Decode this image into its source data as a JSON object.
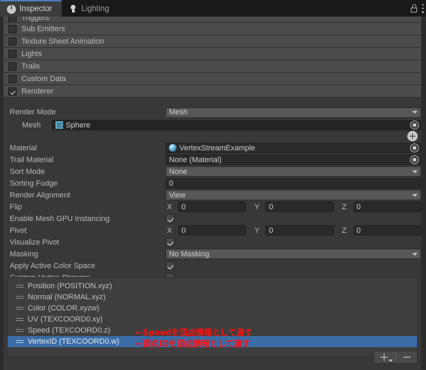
{
  "window": {
    "title": "Inspector",
    "lock_icon": "lock-icon",
    "menu_icon": "kebab-menu-icon"
  },
  "tabs": [
    {
      "label": "Inspector",
      "icon": "info-icon",
      "active": true
    },
    {
      "label": "Lighting",
      "icon": "lightbulb-icon",
      "active": false
    }
  ],
  "modules": [
    {
      "label": "Triggers",
      "checked": false,
      "clipped": true
    },
    {
      "label": "Sub Emitters",
      "checked": false
    },
    {
      "label": "Texture Sheet Animation",
      "checked": false
    },
    {
      "label": "Lights",
      "checked": false
    },
    {
      "label": "Trails",
      "checked": false
    },
    {
      "label": "Custom Data",
      "checked": false
    },
    {
      "label": "Renderer",
      "checked": true
    }
  ],
  "renderer": {
    "render_mode": {
      "label": "Render Mode",
      "value": "Mesh"
    },
    "mesh": {
      "label": "Mesh",
      "value": "Sphere",
      "icon": "mesh-icon",
      "picker": "object-picker-icon"
    },
    "add_mesh_button": "add-icon",
    "material": {
      "label": "Material",
      "value": "VertexStreamExample",
      "icon": "material-sphere-icon",
      "picker": "object-picker-icon"
    },
    "trail_material": {
      "label": "Trail Material",
      "value": "None (Material)",
      "picker": "object-picker-icon"
    },
    "sort_mode": {
      "label": "Sort Mode",
      "value": "None"
    },
    "sorting_fudge": {
      "label": "Sorting Fudge",
      "value": "0"
    },
    "render_alignment": {
      "label": "Render Alignment",
      "value": "View"
    },
    "flip": {
      "label": "Flip",
      "x_label": "X",
      "x": "0",
      "y_label": "Y",
      "y": "0",
      "z_label": "Z",
      "z": "0"
    },
    "gpu_instancing": {
      "label": "Enable Mesh GPU Instancing",
      "checked": true
    },
    "pivot": {
      "label": "Pivot",
      "x_label": "X",
      "x": "0",
      "y_label": "Y",
      "y": "0",
      "z_label": "Z",
      "z": "0"
    },
    "visualize_pivot": {
      "label": "Visualize Pivot",
      "checked": true
    },
    "masking": {
      "label": "Masking",
      "value": "No Masking"
    },
    "apply_active_color_space": {
      "label": "Apply Active Color Space",
      "checked": true
    },
    "custom_vertex_streams": {
      "label": "Custom Vertex Streams",
      "checked": true
    }
  },
  "vertex_streams": {
    "rows": [
      {
        "label": "Position (POSITION.xyz)",
        "selected": false
      },
      {
        "label": "Normal (NORMAL.xyz)",
        "selected": false
      },
      {
        "label": "Color (COLOR.xyzw)",
        "selected": false
      },
      {
        "label": "UV (TEXCOORD0.xy)",
        "selected": false
      },
      {
        "label": "Speed (TEXCOORD0.z)",
        "selected": false
      },
      {
        "label": "VertexID (TEXCOORD0.w)",
        "selected": true
      }
    ],
    "footer": {
      "add_label": "+",
      "remove_label": "−"
    }
  },
  "annotations": [
    {
      "text": "←Speedを頂点情報として渡す",
      "color": "#fb1111"
    },
    {
      "text": "←頂点IDを頂点情報として渡す",
      "color": "#fb1111"
    }
  ]
}
